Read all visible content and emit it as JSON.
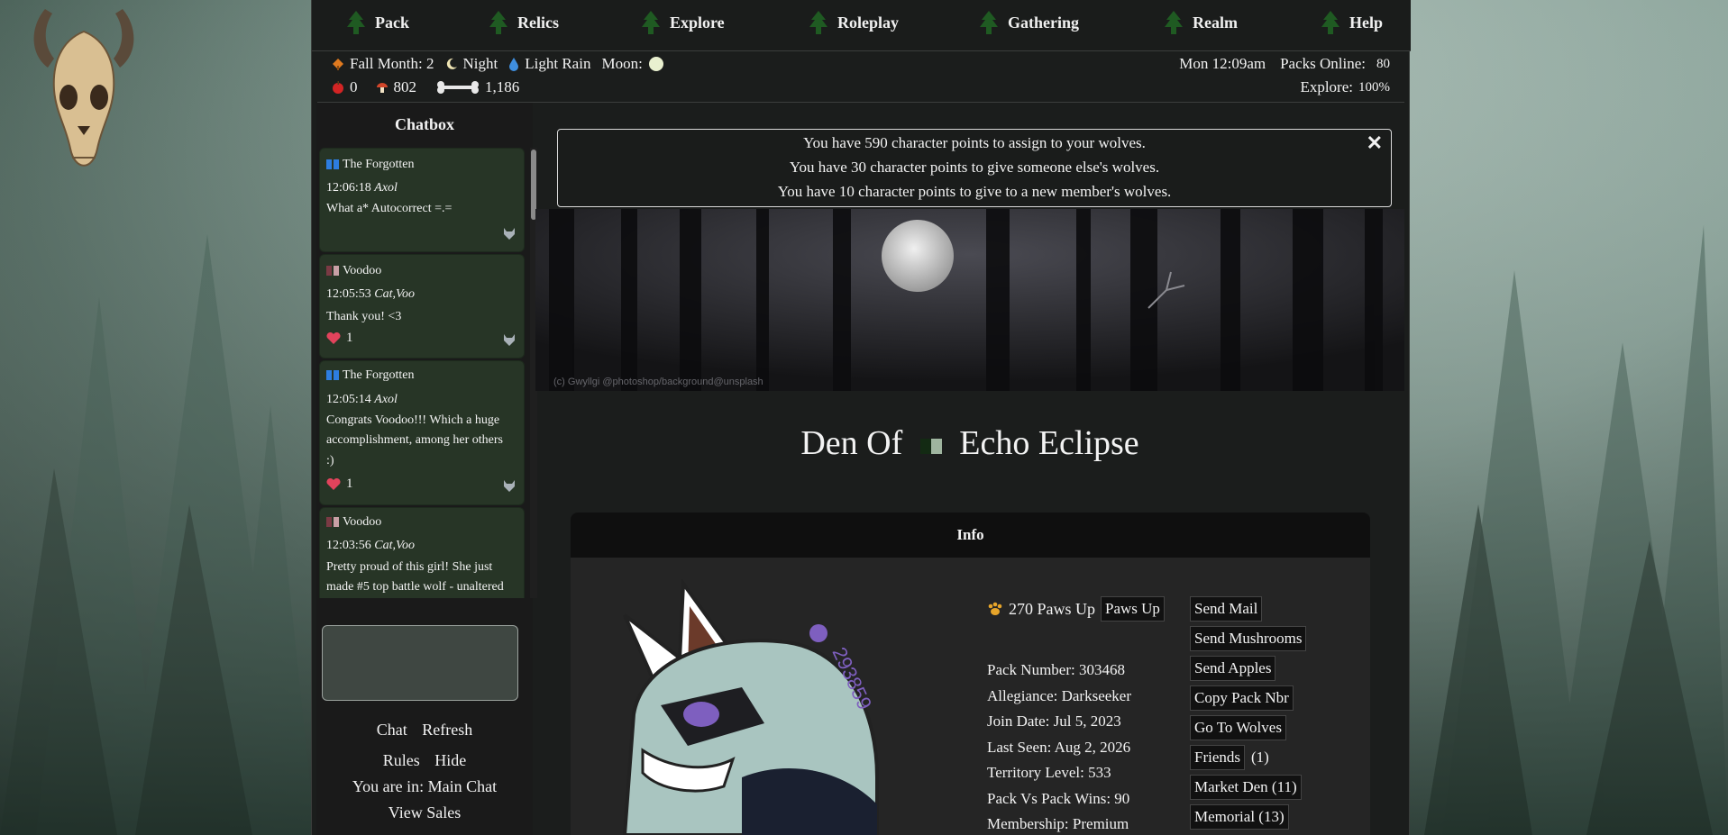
{
  "nav": [
    {
      "label": "Pack",
      "icon": "pine-tree-icon"
    },
    {
      "label": "Relics",
      "icon": "pine-tree-icon"
    },
    {
      "label": "Explore",
      "icon": "pine-tree-icon"
    },
    {
      "label": "Roleplay",
      "icon": "pine-tree-icon"
    },
    {
      "label": "Gathering",
      "icon": "pine-tree-icon"
    },
    {
      "label": "Realm",
      "icon": "pine-tree-icon"
    },
    {
      "label": "Help",
      "icon": "pine-tree-icon"
    }
  ],
  "status": {
    "season": "Fall Month: 2",
    "time_of_day": "Night",
    "weather": "Light Rain",
    "moon_label": "Moon:",
    "apples": "0",
    "mushrooms": "802",
    "bones": "1,186",
    "clock": "Mon 12:09am",
    "packs_online_label": "Packs Online:",
    "packs_online": "80",
    "explore_label": "Explore:",
    "explore_value": "100%"
  },
  "chat": {
    "title": "Chatbox",
    "messages": [
      {
        "pack": "The Forgotten",
        "time": "12:06:18",
        "author": "Axol",
        "text": [
          "What a* Autocorrect =.="
        ],
        "likes": ""
      },
      {
        "pack": "Voodoo",
        "time": "12:05:53",
        "author": "Cat,Voo",
        "text": [
          "Thank you! <3"
        ],
        "likes": "1"
      },
      {
        "pack": "The Forgotten",
        "time": "12:05:14",
        "author": "Axol",
        "text": [
          "Congrats Voodoo!!! Which a huge",
          "accomplishment, among her others",
          ":)"
        ],
        "likes": "1"
      },
      {
        "pack": "Voodoo",
        "time": "12:03:56",
        "author": "Cat,Voo",
        "text": [
          "Pretty proud of this girl! She just",
          "made #5 top battle wolf - unaltered"
        ],
        "likes": ""
      }
    ],
    "links": {
      "chat": "Chat",
      "refresh": "Refresh",
      "rules": "Rules",
      "hide": "Hide"
    },
    "location": "You are in: Main Chat",
    "view_sales": "View Sales"
  },
  "alerts": [
    "You have 590 character points to assign to your wolves.",
    "You have 30 character points to give someone else's wolves.",
    "You have 10 character points to give to a new member's wolves."
  ],
  "banner_credit": "(c) Gwyllgi @photoshop/background@unsplash",
  "den": {
    "prefix": "Den Of",
    "name": "Echo Eclipse"
  },
  "info": {
    "heading": "Info",
    "avatar_number": "293859",
    "paws_up_count": "270 Paws Up",
    "paws_up_button": "Paws Up",
    "details": [
      "Pack Number:  303468",
      "Allegiance: Darkseeker",
      "Join Date: Jul 5, 2023",
      "Last Seen: Aug 2, 2026",
      "Territory Level: 533",
      "Pack Vs Pack Wins: 90",
      "Membership: Premium"
    ],
    "actions": [
      {
        "label": "Send Mail",
        "extra": ""
      },
      {
        "label": "Send Mushrooms",
        "extra": ""
      },
      {
        "label": "Send Apples",
        "extra": ""
      },
      {
        "label": "Copy Pack Nbr",
        "extra": ""
      },
      {
        "label": "Go To Wolves",
        "extra": ""
      },
      {
        "label": "Friends",
        "extra": "(1)"
      },
      {
        "label": "Market Den (11)",
        "extra": ""
      },
      {
        "label": "Memorial (13)",
        "extra": ""
      }
    ]
  },
  "colors": {
    "panel": "#1b1d1c",
    "chat_msg": "#273526",
    "accent_green": "#2f5a2f"
  }
}
